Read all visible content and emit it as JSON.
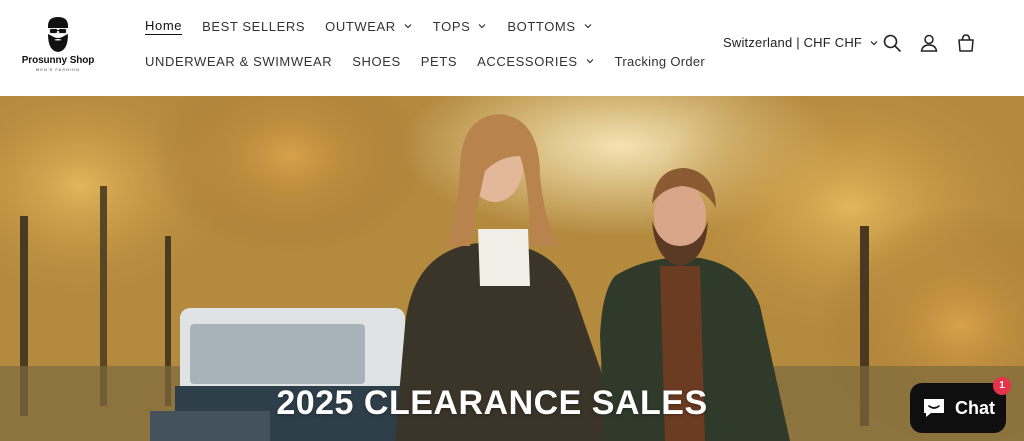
{
  "brand": {
    "name": "Prosunny Shop",
    "tagline": "MEN'S FASHION",
    "logo_icon": "bearded-man-sunglasses-icon"
  },
  "nav": {
    "row1": [
      {
        "label": "Home",
        "active": true,
        "dropdown": false
      },
      {
        "label": "BEST SELLERS",
        "dropdown": false
      },
      {
        "label": "OUTWEAR",
        "dropdown": true
      },
      {
        "label": "TOPS",
        "dropdown": true
      },
      {
        "label": "BOTTOMS",
        "dropdown": true
      }
    ],
    "row2": [
      {
        "label": "UNDERWEAR & SWIMWEAR",
        "dropdown": false
      },
      {
        "label": "SHOES",
        "dropdown": false
      },
      {
        "label": "PETS",
        "dropdown": false
      },
      {
        "label": "ACCESSORIES",
        "dropdown": true
      },
      {
        "label": "Tracking Order",
        "dropdown": false
      }
    ]
  },
  "header": {
    "country_selector": "Switzerland | CHF CHF",
    "icons": [
      "search-icon",
      "account-icon",
      "cart-icon"
    ]
  },
  "hero": {
    "title": "2025 CLEARANCE SALES"
  },
  "chat": {
    "label": "Chat",
    "badge_count": "1",
    "icon": "chat-bubble-icon"
  },
  "colors": {
    "chat_bg": "#0f0f0f",
    "badge": "#e6324b",
    "text": "#222222"
  }
}
